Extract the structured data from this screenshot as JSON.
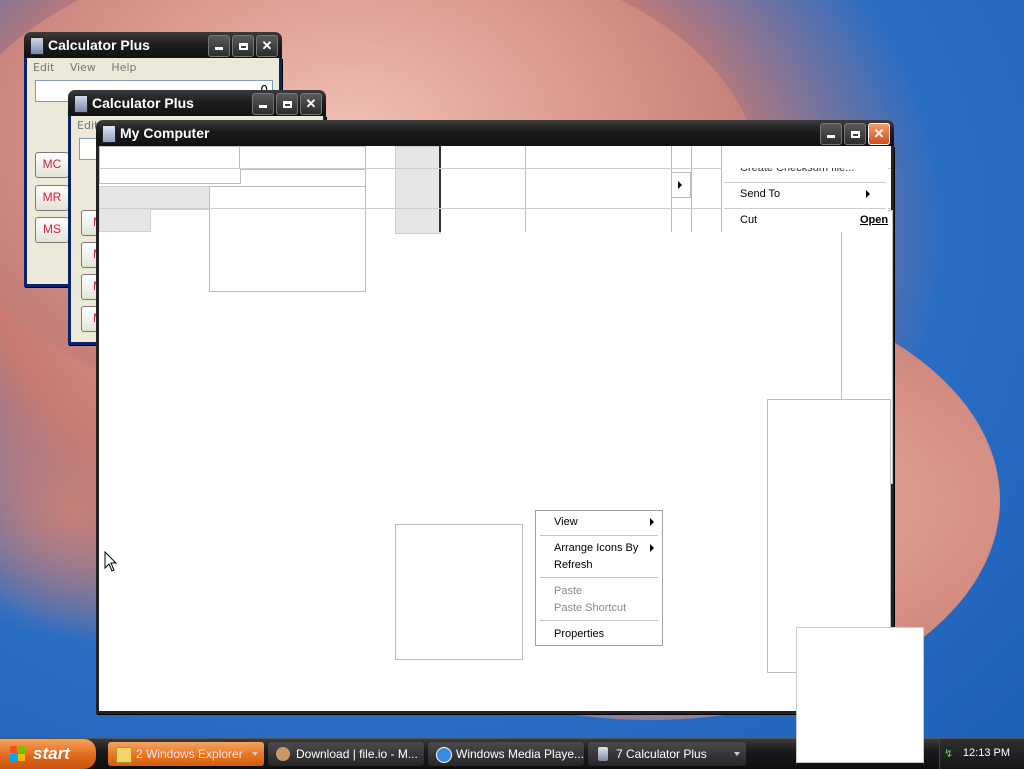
{
  "calc_back": {
    "title": "Calculator Plus",
    "menu": [
      "Edit",
      "View",
      "Help"
    ],
    "display_value": "0",
    "buttons": [
      "MC",
      "MR",
      "MS"
    ]
  },
  "calc_front": {
    "title": "Calculator Plus",
    "menu": [
      "Edit"
    ],
    "buttons": [
      "M",
      "M",
      "M",
      "M"
    ]
  },
  "my_computer": {
    "title": "My Computer"
  },
  "file_menu_fragments": {
    "items": [
      "Create Checksum file...",
      "Send To",
      "Cut"
    ],
    "open_label": "Open"
  },
  "context_menu": {
    "items": [
      {
        "label": "View",
        "submenu": true,
        "enabled": true
      },
      {
        "label": "Arrange Icons By",
        "submenu": true,
        "enabled": true
      },
      {
        "label": "Refresh",
        "submenu": false,
        "enabled": true
      },
      {
        "label": "Paste",
        "submenu": false,
        "enabled": false
      },
      {
        "label": "Paste Shortcut",
        "submenu": false,
        "enabled": false
      },
      {
        "label": "Properties",
        "submenu": false,
        "enabled": true
      }
    ]
  },
  "taskbar": {
    "start_label": "start",
    "tasks": [
      {
        "label": "2 Windows Explorer",
        "icon": "folder-icon",
        "grouped": true
      },
      {
        "label": "Download | file.io - M...",
        "icon": "browser-icon",
        "grouped": false
      },
      {
        "label": "Windows Media Playe...",
        "icon": "media-player-icon",
        "grouped": false
      },
      {
        "label": "7 Calculator Plus",
        "icon": "calculator-icon",
        "grouped": true
      }
    ],
    "clock": "12:13 PM"
  },
  "colors": {
    "start_orange": "#e16a1a",
    "active_task_orange": "#e8751e",
    "calc_button_text": "#d0203a",
    "desktop_blue": "#1a5fb8"
  }
}
